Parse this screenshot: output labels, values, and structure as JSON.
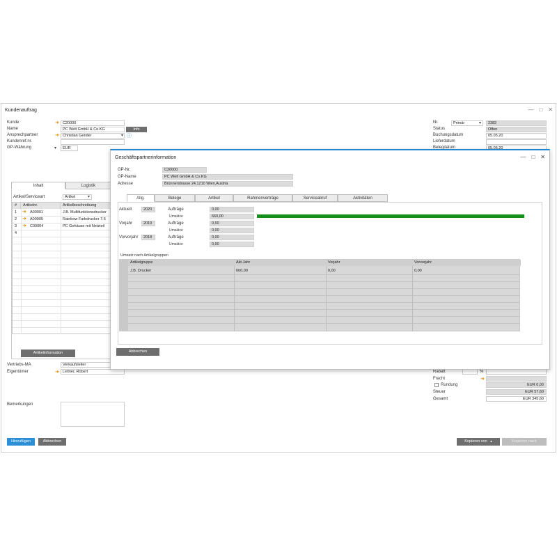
{
  "main": {
    "title": "Kundenauftrag",
    "left_fields": [
      {
        "label": "Kunde",
        "value": "C20000"
      },
      {
        "label": "Name",
        "value": "PC Welt GmbH & Co.KG"
      },
      {
        "label": "Ansprechpartner",
        "value": "Christian Gender"
      },
      {
        "label": "Kundenref.nr.",
        "value": ""
      },
      {
        "label": "GP-Währung",
        "value": "EUR"
      }
    ],
    "info_button": "Info",
    "right_fields": [
      {
        "label": "Nr.",
        "select": "Primär",
        "value": "2382"
      },
      {
        "label": "Status",
        "value": "Offen"
      },
      {
        "label": "Buchungsdatum",
        "value": "05.05.20"
      },
      {
        "label": "Lieferdatum",
        "value": ""
      },
      {
        "label": "Belegdatum",
        "value": "05.05.20"
      }
    ],
    "tabs": [
      "Inhalt",
      "Logistik"
    ],
    "art_type_label": "Artikel/Serviceart",
    "art_type_value": "Artikel",
    "grid_headers": [
      "#",
      "Artikelnr.",
      "Artikelbeschreibung"
    ],
    "grid_rows": [
      {
        "n": "1",
        "item": "A00001",
        "desc": "J.B. Multifunktionsdrucker"
      },
      {
        "n": "2",
        "item": "A00005",
        "desc": "Rainbow Farbdrucker 7.6"
      },
      {
        "n": "3",
        "item": "C00004",
        "desc": "PC Gehäuse mit Netzteil"
      },
      {
        "n": "4",
        "item": "",
        "desc": ""
      }
    ],
    "article_info_button": "Artikelinformation",
    "sales_label": "Vertriebs-MA",
    "sales_value": "Verkaufsleiter",
    "owner_label": "Eigentümer",
    "owner_value": "Leitner, Robert",
    "remarks_label": "Bemerkungen",
    "totals": [
      {
        "label": "Rabatt",
        "value": "",
        "unit": "%"
      },
      {
        "label": "Fracht",
        "value": ""
      },
      {
        "label": "Rundung",
        "value": "EUR 0,00",
        "checkbox": true
      },
      {
        "label": "Steuer",
        "value": "EUR 57,60"
      },
      {
        "label": "Gesamt",
        "value": "EUR 345,60"
      }
    ],
    "add_button": "Hinzufügen",
    "cancel_button": "Abbrechen",
    "copy_from_button": "Kopieren von",
    "copy_to_button": "Kopieren nach"
  },
  "dialog": {
    "title": "Geschäftspartnerinformation",
    "fields": [
      {
        "label": "GP-Nr.",
        "value": "C20000"
      },
      {
        "label": "GP-Name",
        "value": "PC Welt GmbH & Co.KG"
      },
      {
        "label": "Adresse",
        "value": "Brünnerstrasse 24,1210 Wien,Austria"
      }
    ],
    "tabs": [
      "Allg.",
      "Belege",
      "Artikel",
      "Rahmenverträge",
      "Serviceabruf",
      "Aktivitäten"
    ],
    "stats": [
      {
        "period": "Aktuell",
        "year": "2020",
        "orders_label": "Aufträge",
        "orders": "0,00",
        "sales_label": "Umsätze",
        "sales": "660,00"
      },
      {
        "period": "Vorjahr",
        "year": "2019",
        "orders_label": "Aufträge",
        "orders": "0,00",
        "sales_label": "Umsätze",
        "sales": "0,00"
      },
      {
        "period": "Vorvorjahr",
        "year": "2018",
        "orders_label": "Aufträge",
        "orders": "0,00",
        "sales_label": "Umsätze",
        "sales": "0,00"
      }
    ],
    "bar_fraction": 1.0,
    "group_title": "Umsatz nach Artikelgruppen",
    "group_headers": [
      "Artikelgruppe",
      "Akt.Jahr",
      "Vorjahr",
      "Vorvorjahr"
    ],
    "group_rows": [
      {
        "group": "J.B. Drucker",
        "cur": "660,00",
        "prev": "0,00",
        "prev2": "0,00"
      }
    ],
    "cancel_button": "Abbrechen"
  },
  "colors": {
    "accent": "#1f86cf",
    "bar": "#158e1a",
    "link_arrow": "#e08a00"
  }
}
